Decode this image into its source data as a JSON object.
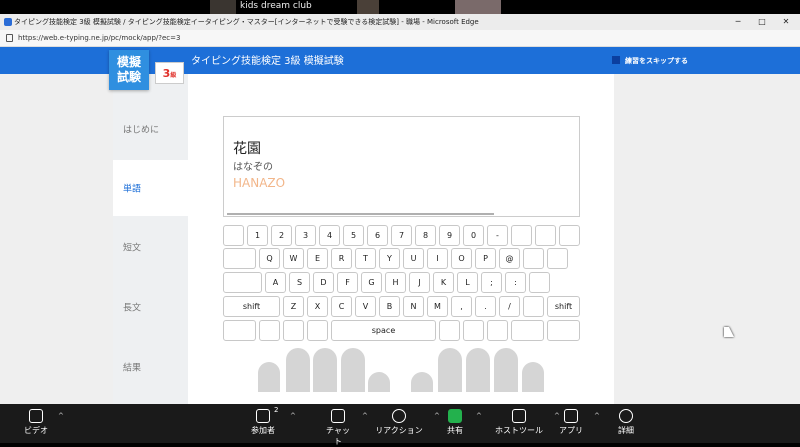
{
  "zoom_top": {
    "label": "kids dream club"
  },
  "window": {
    "title": "タイピング技能検定 3級 模擬試験 / タイピング技能検定イータイピング・マスター[インターネットで受験できる検定試験] - 職場 - Microsoft Edge",
    "minimize": "─",
    "maximize": "□",
    "close": "✕"
  },
  "browser": {
    "url": "https://web.e-typing.ne.jp/pc/mock/app/?ec=3"
  },
  "header": {
    "logo": [
      "模擬",
      "試験"
    ],
    "grade": "3",
    "grade_suffix": "級",
    "title": "タイピング技能検定 3級 模擬試験",
    "skip_label": "練習をスキップする"
  },
  "nav": [
    {
      "label": "はじめに",
      "active": false
    },
    {
      "label": "単語",
      "active": true
    },
    {
      "label": "短文",
      "active": false
    },
    {
      "label": "長文",
      "active": false
    },
    {
      "label": "結果",
      "active": false
    }
  ],
  "word": {
    "kanji": "花園",
    "kana": "はなぞの",
    "roman": "HANAZO"
  },
  "keyboard": {
    "rows": [
      [
        "",
        "1",
        "2",
        "3",
        "4",
        "5",
        "6",
        "7",
        "8",
        "9",
        "0",
        "-",
        "",
        "",
        ""
      ],
      [
        "",
        "Q",
        "W",
        "E",
        "R",
        "T",
        "Y",
        "U",
        "I",
        "O",
        "P",
        "@",
        "",
        ""
      ],
      [
        "",
        "A",
        "S",
        "D",
        "F",
        "G",
        "H",
        "J",
        "K",
        "L",
        ";",
        ":",
        ""
      ],
      [
        "shift",
        "Z",
        "X",
        "C",
        "V",
        "B",
        "N",
        "M",
        ",",
        ".",
        "/",
        "",
        "shift"
      ],
      [
        "",
        "",
        "",
        "",
        "space",
        "",
        "",
        "",
        "",
        ""
      ]
    ]
  },
  "zoom": {
    "items": [
      {
        "label": "ビデオ",
        "icon": "video-icon"
      },
      {
        "label": "参加者",
        "icon": "participants-icon",
        "count": "2"
      },
      {
        "label": "チャット",
        "icon": "chat-icon"
      },
      {
        "label": "リアクション",
        "icon": "reaction-icon"
      },
      {
        "label": "共有",
        "icon": "share-icon"
      },
      {
        "label": "ホストツール",
        "icon": "host-tools-icon"
      },
      {
        "label": "アプリ",
        "icon": "apps-icon"
      },
      {
        "label": "詳細",
        "icon": "more-icon"
      }
    ],
    "caret": "^"
  },
  "colors": {
    "brand": "#1d6fd8",
    "romaji": "#f2b68a",
    "share": "#23b14d"
  }
}
